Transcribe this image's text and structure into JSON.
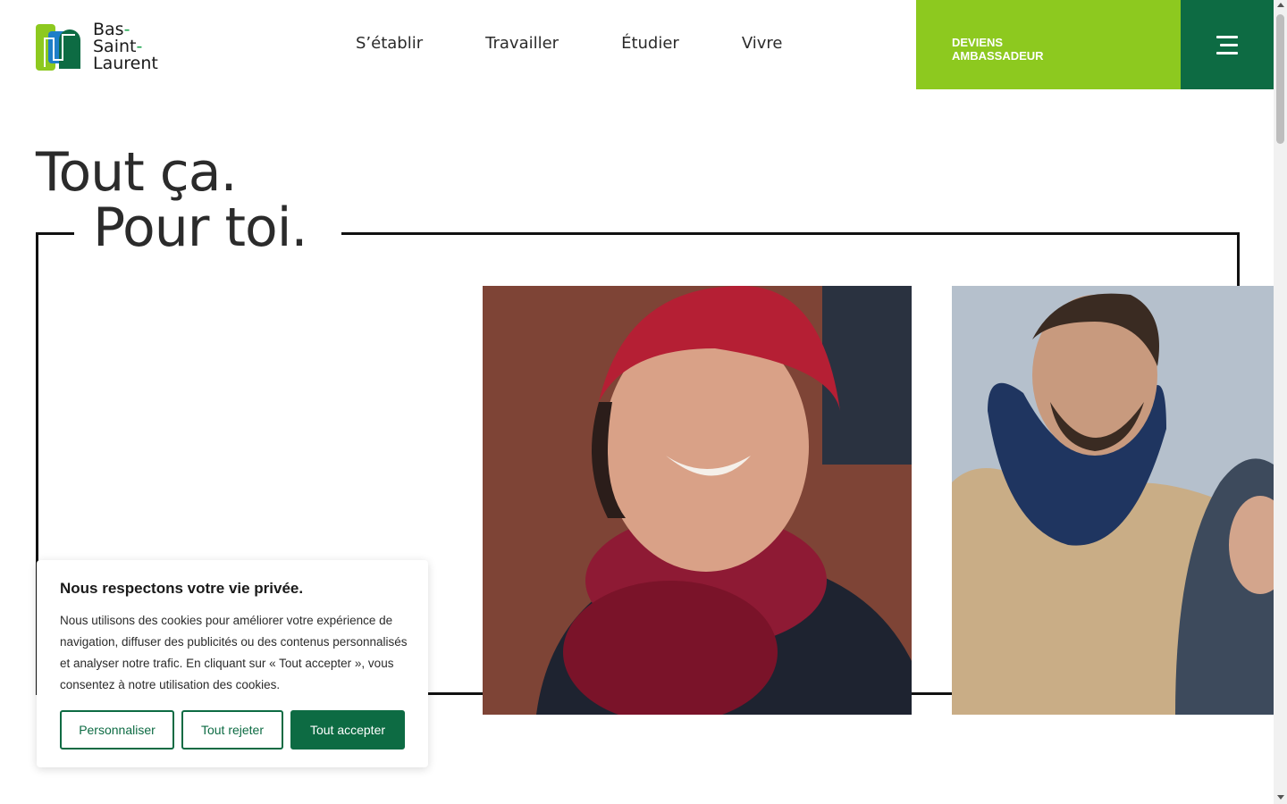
{
  "logo": {
    "line1": "Bas",
    "line2": "Saint",
    "line3": "Laurent",
    "dash": "-",
    "colors": [
      "#8dc91f",
      "#1e7ec8",
      "#0d6b43"
    ]
  },
  "nav": [
    "S’établir",
    "Travailler",
    "Étudier",
    "Vivre"
  ],
  "cta": {
    "line1": "DEVIENS",
    "line2": "AMBASSADEUR"
  },
  "menu_icon": "hamburger-menu-icon",
  "hero": {
    "line1": "Tout ça.",
    "line2": "Pour toi."
  },
  "colors": {
    "accent_green": "#8dc91f",
    "dark_green": "#0d6b43"
  },
  "cookie": {
    "title": "Nous respectons votre vie privée.",
    "text": "Nous utilisons des cookies pour améliorer votre expérience de navigation, diffuser des publicités ou des contenus personnalisés et analyser notre trafic. En cliquant sur « Tout accepter », vous consentez à notre utilisation des cookies.",
    "customize": "Personnaliser",
    "reject": "Tout rejeter",
    "accept": "Tout accepter"
  }
}
